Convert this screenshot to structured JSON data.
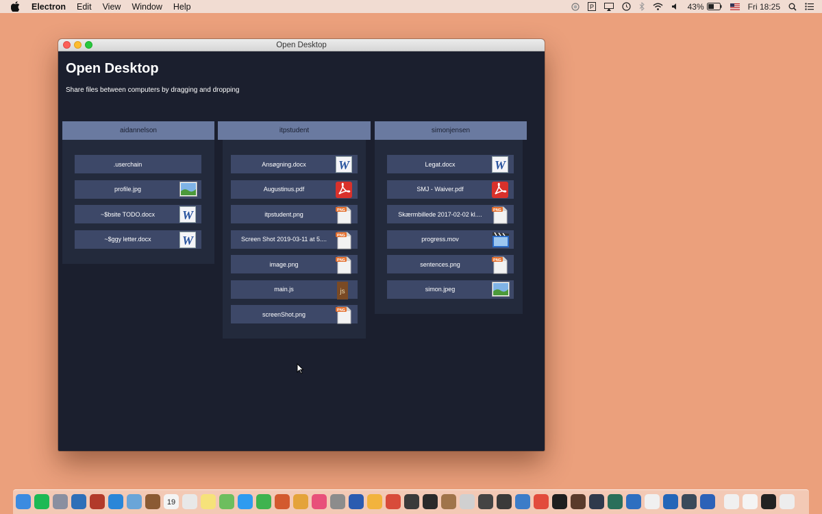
{
  "menubar": {
    "app_name": "Electron",
    "menus": [
      "Edit",
      "View",
      "Window",
      "Help"
    ],
    "battery": "43%",
    "clock": "Fri 18:25"
  },
  "window": {
    "title": "Open Desktop"
  },
  "app": {
    "title": "Open Desktop",
    "subtitle": "Share files between computers by dragging and dropping"
  },
  "users": [
    {
      "name": "aidannelson",
      "files": [
        {
          "name": ".userchain",
          "icon": "none"
        },
        {
          "name": "profile.jpg",
          "icon": "image"
        },
        {
          "name": "~$bsite TODO.docx",
          "icon": "word"
        },
        {
          "name": "~$ggy letter.docx",
          "icon": "word"
        }
      ]
    },
    {
      "name": "itpstudent",
      "files": [
        {
          "name": "Ansøgning.docx",
          "icon": "word"
        },
        {
          "name": "Augustinus.pdf",
          "icon": "pdf"
        },
        {
          "name": "itpstudent.png",
          "icon": "png"
        },
        {
          "name": "Screen Shot 2019-03-11 at 5....",
          "icon": "png"
        },
        {
          "name": "image.png",
          "icon": "png"
        },
        {
          "name": "main.js",
          "icon": "js"
        },
        {
          "name": "screenShot.png",
          "icon": "png"
        }
      ]
    },
    {
      "name": "simonjensen",
      "files": [
        {
          "name": "Legat.docx",
          "icon": "word"
        },
        {
          "name": "SMJ - Waiver.pdf",
          "icon": "pdf"
        },
        {
          "name": "Skærmbillede 2017-02-02 kl....",
          "icon": "png"
        },
        {
          "name": "progress.mov",
          "icon": "movie"
        },
        {
          "name": "sentences.png",
          "icon": "png"
        },
        {
          "name": "simon.jpeg",
          "icon": "image"
        }
      ]
    }
  ],
  "icon_labels": {
    "png": "PNG",
    "js": "js",
    "word": "W"
  },
  "dock": {
    "apps": [
      "finder-icon",
      "spotify-icon",
      "launchpad-icon",
      "compass-icon",
      "photo-booth-icon",
      "safari-icon",
      "preview-icon",
      "notebook-icon",
      "calendar-icon",
      "textedit-icon",
      "notes-icon",
      "maps-icon",
      "messages-icon",
      "facetime-icon",
      "photo-icon",
      "pinwheel-icon",
      "itunes-icon",
      "system-preferences-icon",
      "word-icon",
      "sketch-icon",
      "git-icon",
      "activity-monitor-icon",
      "p-icon",
      "box-icon",
      "disk-utility-icon",
      "app-icon",
      "dash-icon",
      "shield-icon",
      "chrome-icon",
      "terminal-icon",
      "tool-icon",
      "electron-icon",
      "atom-icon",
      "vscode-icon",
      "document-icon",
      "vscode-2-icon",
      "electron-2-icon",
      "quicktime-icon",
      "folder-icon",
      "window-icon",
      "screen-icon",
      "trash-icon"
    ],
    "calendar_day": "19"
  },
  "colors": {
    "desktop": "#EBA07C",
    "window_bg": "#1B1F2E",
    "column_header": "#6A7AA0",
    "column_body": "#232A3C",
    "file_row": "#3D4868"
  }
}
